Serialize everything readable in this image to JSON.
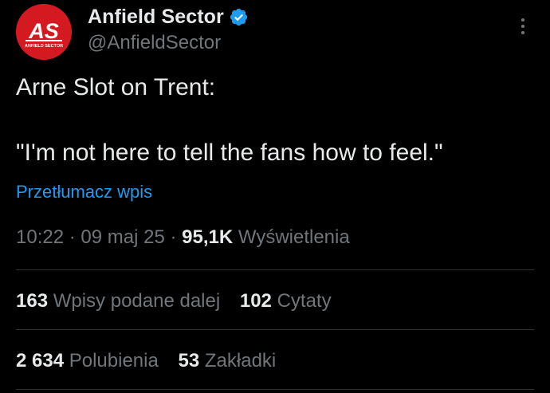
{
  "author": {
    "display_name": "Anfield Sector",
    "handle": "@AnfieldSector",
    "avatar_text": "AS",
    "avatar_subtext": "ANFIELD SECTOR",
    "verified_icon": "verified-badge-icon"
  },
  "tweet": {
    "line1": "Arne Slot on Trent:",
    "line2": "\"I'm not here to tell the fans how to feel.\"",
    "translate_label": "Przetłumacz wpis"
  },
  "meta": {
    "time": "10:22",
    "separator": "·",
    "date": "09 maj 25",
    "views_count": "95,1K",
    "views_label": "Wyświetlenia"
  },
  "stats_row1": {
    "reposts_count": "163",
    "reposts_label": "Wpisy podane dalej",
    "quotes_count": "102",
    "quotes_label": "Cytaty"
  },
  "stats_row2": {
    "likes_count": "2 634",
    "likes_label": "Polubienia",
    "bookmarks_count": "53",
    "bookmarks_label": "Zakładki"
  },
  "colors": {
    "background": "#000000",
    "text_primary": "#e7e9ea",
    "text_secondary": "#71767b",
    "link": "#1d9bf0",
    "verified": "#1d9bf0",
    "avatar_red": "#d41920",
    "divider": "#2f3336"
  }
}
